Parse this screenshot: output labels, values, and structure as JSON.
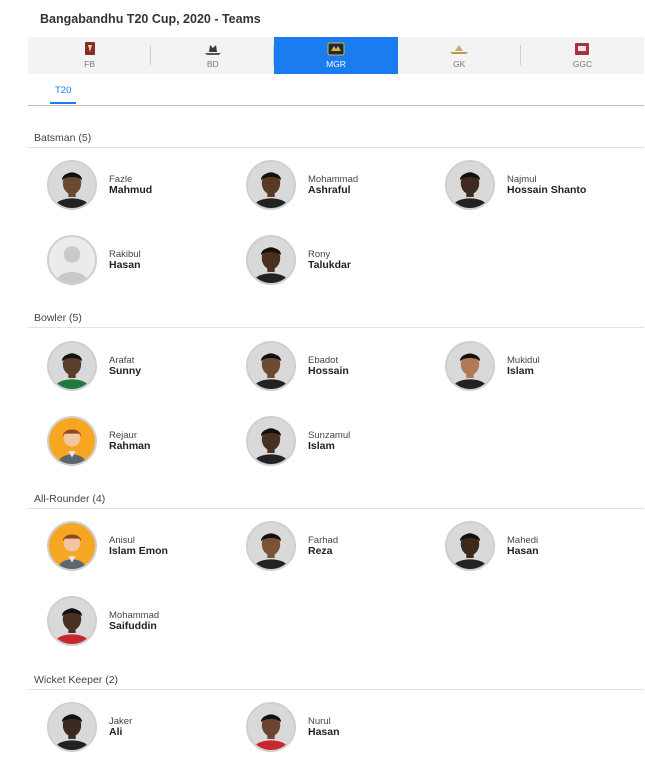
{
  "page": {
    "title": "Bangabandhu T20 Cup, 2020 - Teams"
  },
  "team_tabs": [
    {
      "label": "FB",
      "active": false,
      "icon": "fb-logo-icon"
    },
    {
      "label": "BD",
      "active": false,
      "icon": "bd-logo-icon"
    },
    {
      "label": "MGR",
      "active": true,
      "icon": "mgr-logo-icon"
    },
    {
      "label": "GK",
      "active": false,
      "icon": "gk-logo-icon"
    },
    {
      "label": "GGC",
      "active": false,
      "icon": "ggc-logo-icon"
    }
  ],
  "format_tab": {
    "label": "T20"
  },
  "sections": [
    {
      "title": "Batsman (5)",
      "players": [
        {
          "first": "Fazle",
          "last": "Mahmud",
          "avatar": "photo"
        },
        {
          "first": "Mohammad",
          "last": "Ashraful",
          "avatar": "photo"
        },
        {
          "first": "Najmul",
          "last": "Hossain Shanto",
          "avatar": "photo"
        },
        {
          "first": "Rakibul",
          "last": "Hasan",
          "avatar": "placeholder"
        },
        {
          "first": "Rony",
          "last": "Talukdar",
          "avatar": "photo"
        }
      ]
    },
    {
      "title": "Bowler (5)",
      "players": [
        {
          "first": "Arafat",
          "last": "Sunny",
          "avatar": "photo"
        },
        {
          "first": "Ebadot",
          "last": "Hossain",
          "avatar": "photo"
        },
        {
          "first": "Mukidul",
          "last": "Islam",
          "avatar": "photo"
        },
        {
          "first": "Rejaur",
          "last": "Rahman",
          "avatar": "default-orange"
        },
        {
          "first": "Sunzamul",
          "last": "Islam",
          "avatar": "photo"
        }
      ]
    },
    {
      "title": "All-Rounder (4)",
      "players": [
        {
          "first": "Anisul",
          "last": "Islam Emon",
          "avatar": "default-orange"
        },
        {
          "first": "Farhad",
          "last": "Reza",
          "avatar": "photo"
        },
        {
          "first": "Mahedi",
          "last": "Hasan",
          "avatar": "photo"
        },
        {
          "first": "Mohammad",
          "last": "Saifuddin",
          "avatar": "photo"
        }
      ]
    },
    {
      "title": "Wicket Keeper (2)",
      "players": [
        {
          "first": "Jaker",
          "last": "Ali",
          "avatar": "photo"
        },
        {
          "first": "Nurul",
          "last": "Hasan",
          "avatar": "photo"
        }
      ]
    }
  ],
  "colors": {
    "accent": "#1a7cf0",
    "default_avatar_bg": "#f6a623"
  }
}
